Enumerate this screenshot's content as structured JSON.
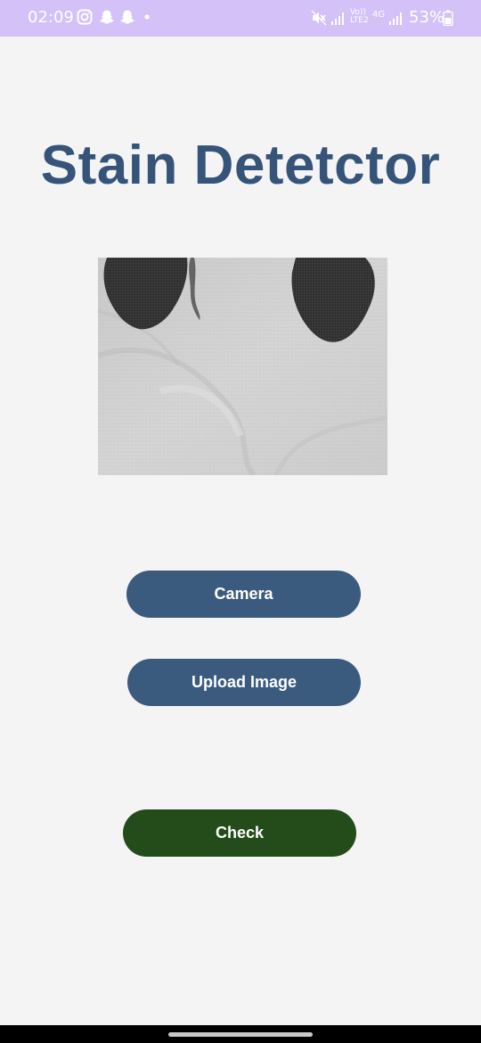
{
  "status_bar": {
    "time": "02:09",
    "left_icons": [
      "instagram-icon",
      "snapchat-icon",
      "snapchat-icon",
      "dot-icon"
    ],
    "right_icons": [
      "mute-icon",
      "signal-icon",
      "volte-icon",
      "4g-icon",
      "signal-icon",
      "battery-icon"
    ],
    "volte_label": "Vo)) LTE2",
    "network_label": "4G",
    "battery_percent": "53%",
    "background_color": "#d3c1f7"
  },
  "app": {
    "title": "Stain Detetctor",
    "title_color": "#365479"
  },
  "preview": {
    "content": "fabric-stain-photo"
  },
  "buttons": {
    "camera_label": "Camera",
    "upload_label": "Upload Image",
    "check_label": "Check",
    "primary_color": "#3b5b7e",
    "check_color": "#244b1a"
  }
}
